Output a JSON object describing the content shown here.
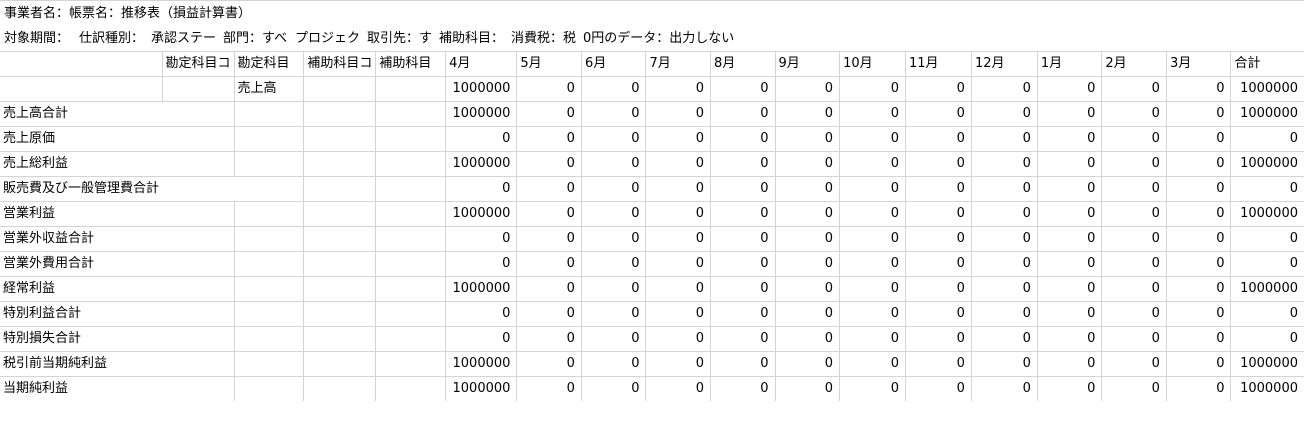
{
  "header": {
    "row1": "事業者名：帳票名：推移表（損益計算書）",
    "row2": [
      "対象期間：",
      "仕訳種別：",
      "承認ステー",
      "部門：すべ",
      "プロジェク",
      "取引先：す",
      "補助科目：",
      "消費税：税",
      "0円のデータ：出力しない"
    ]
  },
  "columns": [
    "",
    "勘定科目コ",
    "勘定科目",
    "補助科目コ",
    "補助科目",
    "4月",
    "5月",
    "6月",
    "7月",
    "8月",
    "9月",
    "10月",
    "11月",
    "12月",
    "1月",
    "2月",
    "3月",
    "合計"
  ],
  "rows": [
    {
      "label": "",
      "sub": "売上高",
      "values": [
        "1000000",
        "0",
        "0",
        "0",
        "0",
        "0",
        "0",
        "0",
        "0",
        "0",
        "0",
        "0",
        "1000000"
      ]
    },
    {
      "label": "売上高合計",
      "sub": "",
      "values": [
        "1000000",
        "0",
        "0",
        "0",
        "0",
        "0",
        "0",
        "0",
        "0",
        "0",
        "0",
        "0",
        "1000000"
      ]
    },
    {
      "label": "売上原価",
      "sub": "",
      "values": [
        "0",
        "0",
        "0",
        "0",
        "0",
        "0",
        "0",
        "0",
        "0",
        "0",
        "0",
        "0",
        "0"
      ]
    },
    {
      "label": "売上総利益",
      "sub": "",
      "values": [
        "1000000",
        "0",
        "0",
        "0",
        "0",
        "0",
        "0",
        "0",
        "0",
        "0",
        "0",
        "0",
        "1000000"
      ]
    },
    {
      "label": "販売費及び一般管理費合計",
      "sub": "",
      "values": [
        "0",
        "0",
        "0",
        "0",
        "0",
        "0",
        "0",
        "0",
        "0",
        "0",
        "0",
        "0",
        "0"
      ]
    },
    {
      "label": "営業利益",
      "sub": "",
      "values": [
        "1000000",
        "0",
        "0",
        "0",
        "0",
        "0",
        "0",
        "0",
        "0",
        "0",
        "0",
        "0",
        "1000000"
      ]
    },
    {
      "label": "営業外収益合計",
      "sub": "",
      "values": [
        "0",
        "0",
        "0",
        "0",
        "0",
        "0",
        "0",
        "0",
        "0",
        "0",
        "0",
        "0",
        "0"
      ]
    },
    {
      "label": "営業外費用合計",
      "sub": "",
      "values": [
        "0",
        "0",
        "0",
        "0",
        "0",
        "0",
        "0",
        "0",
        "0",
        "0",
        "0",
        "0",
        "0"
      ]
    },
    {
      "label": "経常利益",
      "sub": "",
      "values": [
        "1000000",
        "0",
        "0",
        "0",
        "0",
        "0",
        "0",
        "0",
        "0",
        "0",
        "0",
        "0",
        "1000000"
      ]
    },
    {
      "label": "特別利益合計",
      "sub": "",
      "values": [
        "0",
        "0",
        "0",
        "0",
        "0",
        "0",
        "0",
        "0",
        "0",
        "0",
        "0",
        "0",
        "0"
      ]
    },
    {
      "label": "特別損失合計",
      "sub": "",
      "values": [
        "0",
        "0",
        "0",
        "0",
        "0",
        "0",
        "0",
        "0",
        "0",
        "0",
        "0",
        "0",
        "0"
      ]
    },
    {
      "label": "税引前当期純利益",
      "sub": "",
      "values": [
        "1000000",
        "0",
        "0",
        "0",
        "0",
        "0",
        "0",
        "0",
        "0",
        "0",
        "0",
        "0",
        "1000000"
      ]
    },
    {
      "label": "当期純利益",
      "sub": "",
      "values": [
        "1000000",
        "0",
        "0",
        "0",
        "0",
        "0",
        "0",
        "0",
        "0",
        "0",
        "0",
        "0",
        "1000000"
      ]
    }
  ]
}
